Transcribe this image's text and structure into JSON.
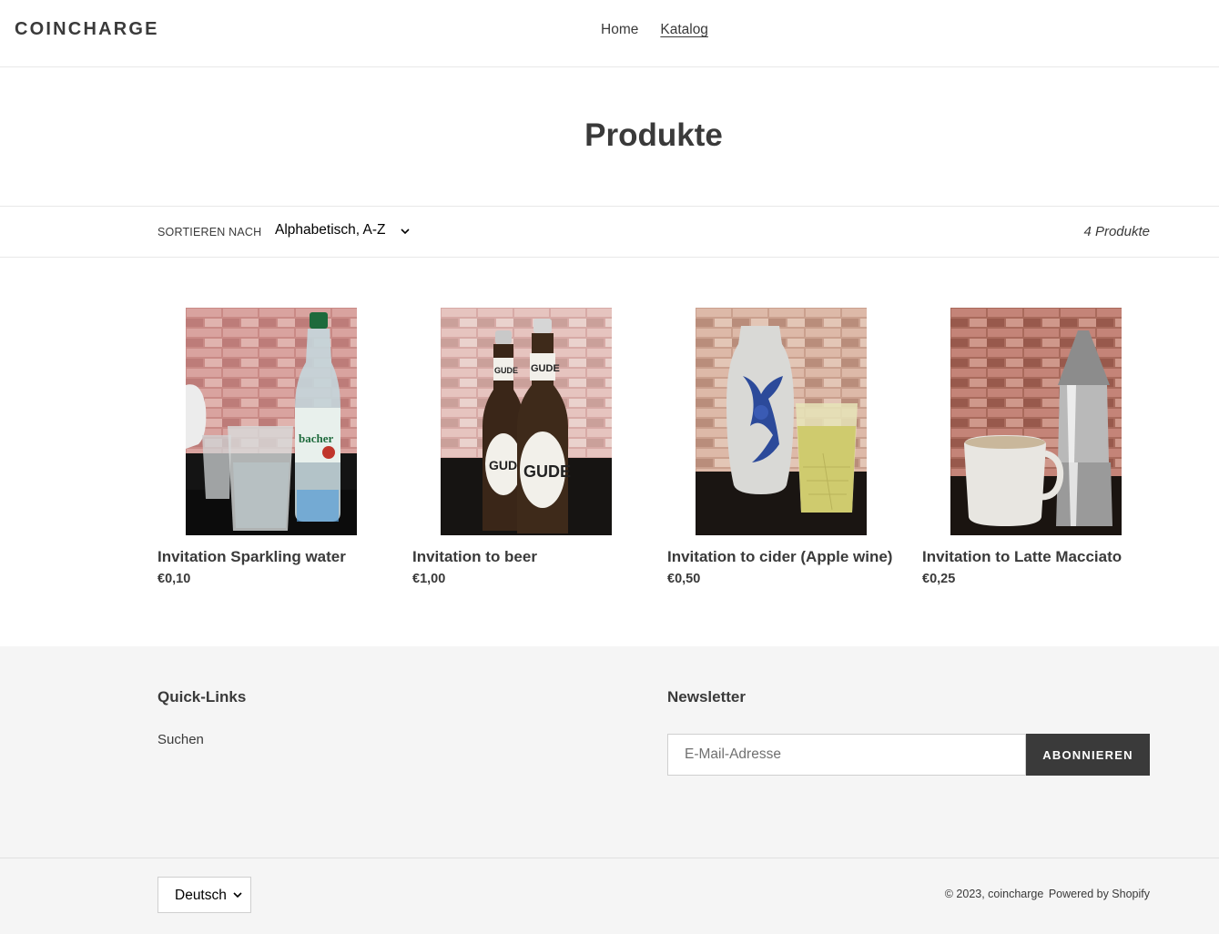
{
  "header": {
    "logo": "COINCHARGE",
    "nav": [
      {
        "label": "Home",
        "active": false
      },
      {
        "label": "Katalog",
        "active": true
      }
    ]
  },
  "page_title": "Produkte",
  "filter": {
    "sort_label": "SORTIEREN NACH",
    "sort_value": "Alphabetisch, A-Z",
    "count": "4 Produkte"
  },
  "products": [
    {
      "title": "Invitation Sparkling water",
      "price": "€0,10"
    },
    {
      "title": "Invitation to beer",
      "price": "€1,00"
    },
    {
      "title": "Invitation to cider (Apple wine)",
      "price": "€0,50"
    },
    {
      "title": "Invitation to Latte Macciato",
      "price": "€0,25"
    }
  ],
  "footer": {
    "quick_links_title": "Quick-Links",
    "quick_links": [
      {
        "label": "Suchen"
      }
    ],
    "newsletter_title": "Newsletter",
    "email_placeholder": "E-Mail-Adresse",
    "subscribe_label": "ABONNIEREN",
    "language": "Deutsch",
    "copyright": "© 2023, coincharge",
    "powered": "Powered by Shopify"
  },
  "colors": {
    "text": "#3a3a3a",
    "footer_bg": "#f5f5f5",
    "button_bg": "#3a3a3a"
  }
}
